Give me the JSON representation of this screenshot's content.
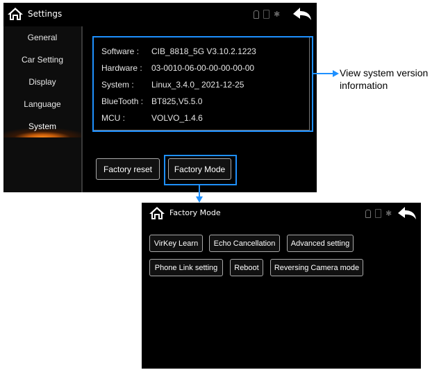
{
  "settings_screen": {
    "title": "Settings",
    "sidebar": {
      "items": [
        {
          "label": "General"
        },
        {
          "label": "Car Setting"
        },
        {
          "label": "Display"
        },
        {
          "label": "Language"
        },
        {
          "label": "System",
          "active": true
        }
      ]
    },
    "system_info": [
      {
        "key": "Software :",
        "value": "CIB_8818_5G V3.10.2.1223"
      },
      {
        "key": "Hardware :",
        "value": "03-0010-06-00-00-00-00-00"
      },
      {
        "key": "System :",
        "value": "Linux_3.4.0_ 2021-12-25"
      },
      {
        "key": "BlueTooth :",
        "value": "BT825,V5.5.0"
      },
      {
        "key": "MCU :",
        "value": "VOLVO_1.4.6"
      }
    ],
    "buttons": {
      "factory_reset": "Factory reset",
      "factory_mode": "Factory Mode"
    }
  },
  "annotation": {
    "line1": "View system version",
    "line2": "information"
  },
  "factory_screen": {
    "title": "Factory Mode",
    "buttons": [
      {
        "label": "VirKey Learn"
      },
      {
        "label": "Echo Cancellation"
      },
      {
        "label": "Advanced setting"
      },
      {
        "label": "Phone Link setting"
      },
      {
        "label": "Reboot"
      },
      {
        "label": "Reversing Camera mode"
      }
    ]
  },
  "icons": {
    "home": "home-icon",
    "back": "back-arrow-icon",
    "usb": "usb-icon",
    "phone": "phone-icon",
    "bluetooth": "bluetooth-icon"
  },
  "colors": {
    "highlight": "#1e90ff",
    "active_glow": "#ff8a1a",
    "background": "#000000"
  }
}
